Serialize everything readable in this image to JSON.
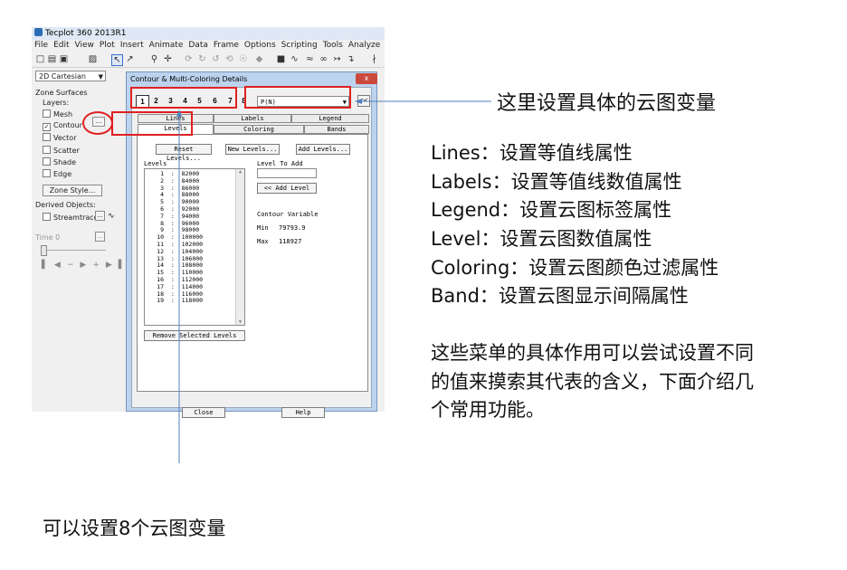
{
  "app": {
    "title": "Tecplot 360 2013R1"
  },
  "menu": [
    "File",
    "Edit",
    "View",
    "Plot",
    "Insert",
    "Animate",
    "Data",
    "Frame",
    "Options",
    "Scripting",
    "Tools",
    "Analyze"
  ],
  "sidebar": {
    "plot_type": "2D Cartesian",
    "zone_surfaces": "Zone Surfaces",
    "layers": "Layers:",
    "layer_items": [
      {
        "label": "Mesh",
        "checked": false
      },
      {
        "label": "Contour",
        "checked": true
      },
      {
        "label": "Vector",
        "checked": false
      },
      {
        "label": "Scatter",
        "checked": false
      },
      {
        "label": "Shade",
        "checked": false
      },
      {
        "label": "Edge",
        "checked": false
      }
    ],
    "contour_details_btn": "...",
    "zone_style_btn": "Zone Style...",
    "derived_objects": "Derived Objects:",
    "streamtraces": "Streamtraces",
    "streamtraces_btn": "...",
    "time_label": "Time",
    "time_value": "0",
    "time_btn": "..."
  },
  "dialog": {
    "title": "Contour & Multi-Coloring Details",
    "close": "x",
    "group_numbers": [
      "1",
      "2",
      "3",
      "4",
      "5",
      "6",
      "7",
      "8"
    ],
    "variable": "P(N)",
    "arrow_btn": "<<",
    "tabs_top": [
      "Lines",
      "Labels",
      "Legend"
    ],
    "tabs_bottom": [
      "Levels",
      "Coloring",
      "Bands"
    ],
    "reset_levels": "Reset Levels...",
    "new_levels": "New Levels...",
    "add_levels": "Add Levels...",
    "levels_label": "Levels",
    "levels": [
      {
        "i": "1",
        "v": "82000"
      },
      {
        "i": "2",
        "v": "84000"
      },
      {
        "i": "3",
        "v": "86000"
      },
      {
        "i": "4",
        "v": "88000"
      },
      {
        "i": "5",
        "v": "90000"
      },
      {
        "i": "6",
        "v": "92000"
      },
      {
        "i": "7",
        "v": "94000"
      },
      {
        "i": "8",
        "v": "96000"
      },
      {
        "i": "9",
        "v": "98000"
      },
      {
        "i": "10",
        "v": "100000"
      },
      {
        "i": "11",
        "v": "102000"
      },
      {
        "i": "12",
        "v": "104000"
      },
      {
        "i": "13",
        "v": "106000"
      },
      {
        "i": "14",
        "v": "108000"
      },
      {
        "i": "15",
        "v": "110000"
      },
      {
        "i": "16",
        "v": "112000"
      },
      {
        "i": "17",
        "v": "114000"
      },
      {
        "i": "18",
        "v": "116000"
      },
      {
        "i": "19",
        "v": "118000"
      }
    ],
    "level_to_add": "Level To Add",
    "add_level_btn": "<< Add Level",
    "contour_variable": "Contour Variable",
    "min_label": "Min",
    "min_value": "79793.9",
    "max_label": "Max",
    "max_value": "118927",
    "remove_selected": "Remove Selected Levels",
    "close_btn": "Close",
    "help_btn": "Help"
  },
  "annotations": {
    "variable_note": "这里设置具体的云图变量",
    "lines": "Lines：设置等值线属性",
    "labels": "Labels：设置等值线数值属性",
    "legend": "Legend：设置云图标签属性",
    "level": "Level：设置云图数值属性",
    "coloring": "Coloring：设置云图颜色过滤属性",
    "band": "Band：设置云图显示间隔属性",
    "para1": "这些菜单的具体作用可以尝试设置不同",
    "para2": "的值来摸索其代表的含义，下面介绍几",
    "para3": "个常用功能。",
    "bottom_note": "可以设置8个云图变量"
  },
  "colors": {
    "highlight": "#e02020",
    "arrow": "#4f81bd",
    "dialog_frame": "#bcd3ee"
  }
}
